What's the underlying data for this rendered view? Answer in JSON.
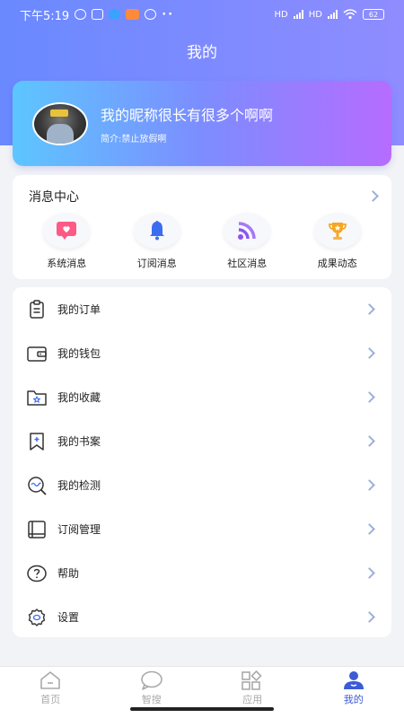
{
  "status_bar": {
    "time": "下午5:19",
    "network_labels": [
      "HD",
      "HD"
    ],
    "battery": "62"
  },
  "header": {
    "title": "我的"
  },
  "profile": {
    "nickname": "我的昵称很长有很多个啊啊",
    "intro": "简介:禁止放假啊"
  },
  "message_center": {
    "title": "消息中心",
    "items": [
      {
        "label": "系统消息",
        "icon": "message-heart-icon",
        "color": "#ff4f7a"
      },
      {
        "label": "订阅消息",
        "icon": "bell-icon",
        "color": "#3b6df0"
      },
      {
        "label": "社区消息",
        "icon": "feed-icon",
        "color": "#8a54f0"
      },
      {
        "label": "成果动态",
        "icon": "trophy-icon",
        "color": "#f5a623"
      }
    ]
  },
  "menu": {
    "items": [
      {
        "label": "我的订单",
        "icon": "clipboard-icon"
      },
      {
        "label": "我的钱包",
        "icon": "wallet-icon"
      },
      {
        "label": "我的收藏",
        "icon": "folder-star-icon"
      },
      {
        "label": "我的书案",
        "icon": "bookmark-plus-icon"
      },
      {
        "label": "我的检测",
        "icon": "magnifier-wave-icon"
      },
      {
        "label": "订阅管理",
        "icon": "book-icon"
      },
      {
        "label": "帮助",
        "icon": "help-icon"
      },
      {
        "label": "设置",
        "icon": "settings-icon"
      }
    ]
  },
  "bottom_nav": {
    "items": [
      {
        "label": "首页",
        "icon": "home-icon",
        "active": false
      },
      {
        "label": "智搜",
        "icon": "chat-search-icon",
        "active": false
      },
      {
        "label": "应用",
        "icon": "apps-icon",
        "active": false
      },
      {
        "label": "我的",
        "icon": "user-icon",
        "active": true
      }
    ],
    "active_color": "#3c5bd6",
    "inactive_color": "#aaaaaa"
  }
}
